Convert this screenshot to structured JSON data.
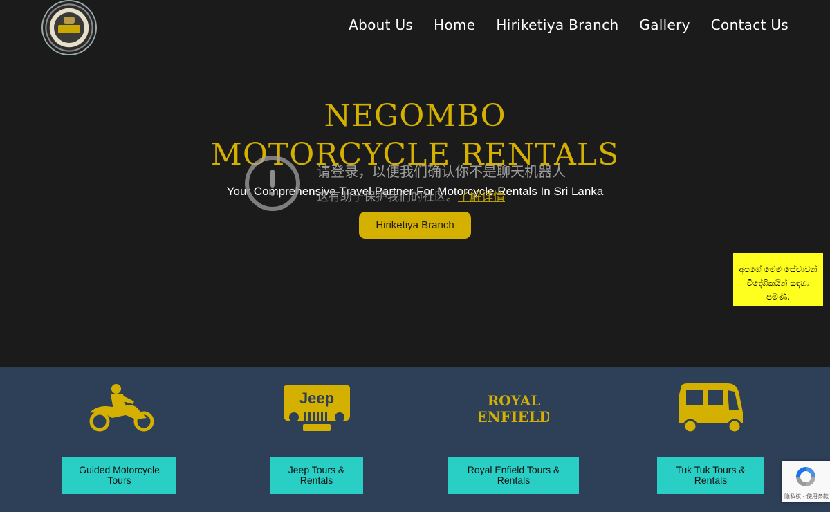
{
  "nav": {
    "items": [
      "About Us",
      "Home",
      "Hiriketiya Branch",
      "Gallery",
      "Contact Us"
    ]
  },
  "hero": {
    "title_line1": "NEGOMBO",
    "title_line2": "MOTORCYCLE  RENTALS",
    "subtitle": "Your Comprehensive Travel Partner For Motorcycle Rentals In Sri Lanka",
    "button_label": "Hiriketiya Branch"
  },
  "overlay": {
    "line1": "请登录，以便我们确认你不是聊天机器人",
    "line2_prefix": "这有助于保护我们的社区。",
    "line2_link": "了解详情"
  },
  "side_note": {
    "text": "අපගේ මෙම සේවාවන් විදේශිකයින් සඳහා පමණි."
  },
  "services": [
    {
      "label": "Guided Motorcycle Tours",
      "icon": "motorcycle-rider-icon"
    },
    {
      "label": "Jeep Tours & Rentals",
      "icon": "jeep-logo-icon",
      "icon_text": "Jeep"
    },
    {
      "label": "Royal Enfield Tours & Rentals",
      "icon": "royal-enfield-logo-icon",
      "icon_text_1": "ROYAL",
      "icon_text_2": "ENFIELD"
    },
    {
      "label": "Tuk Tuk Tours & Rentals",
      "icon": "tuk-tuk-icon"
    }
  ],
  "recaptcha": {
    "terms": "隐私权 - 使用条款"
  },
  "colors": {
    "background": "#1b1b1b",
    "gold": "#d4b000",
    "services_band": "#2e4058",
    "teal": "#29cfc4",
    "note_yellow": "#ffff1f"
  }
}
